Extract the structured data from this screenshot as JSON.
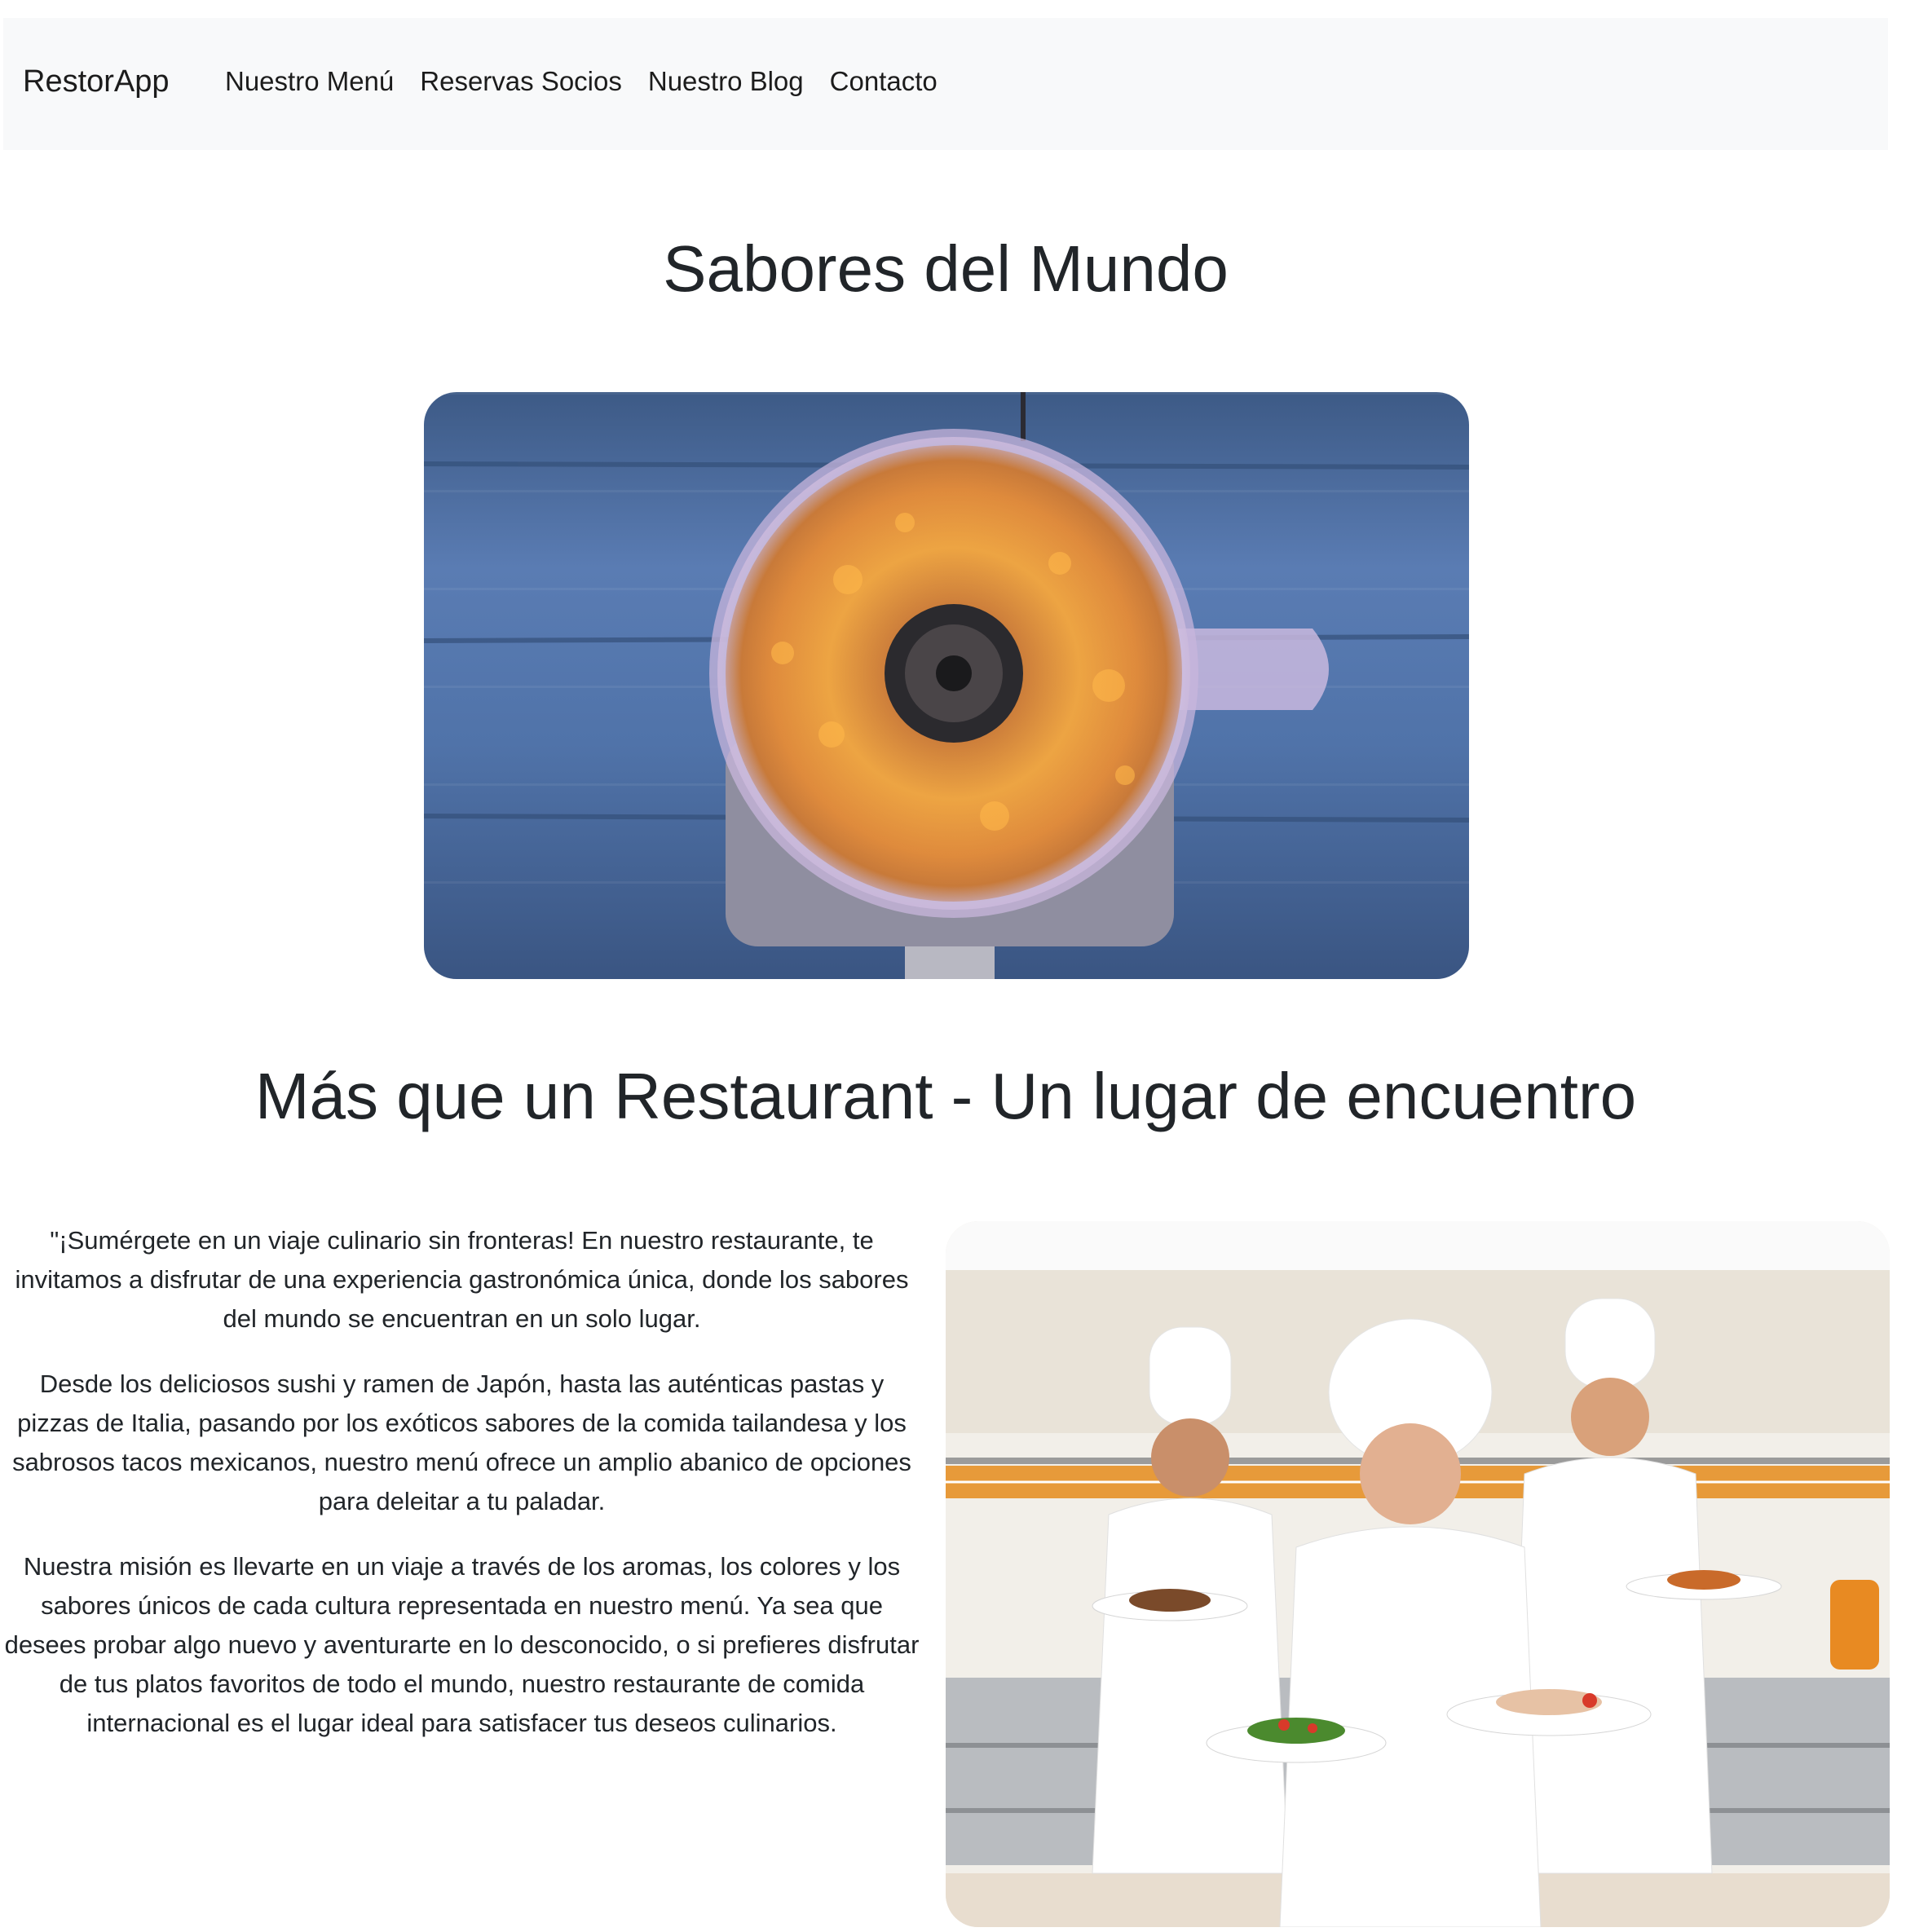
{
  "navbar": {
    "brand": "RestorApp",
    "links": [
      "Nuestro Menú",
      "Reservas Socios",
      "Nuestro Blog",
      "Contacto"
    ]
  },
  "hero": {
    "title": "Sabores del Mundo"
  },
  "about": {
    "heading": "Más que un Restaurant - Un lugar de encuentro",
    "paragraphs": [
      "\"¡Sumérgete en un viaje culinario sin fronteras! En nuestro restaurante, te invitamos a disfrutar de una experiencia gastronómica única, donde los sabores del mundo se encuentran en un solo lugar.",
      "Desde los deliciosos sushi y ramen de Japón, hasta las auténticas pastas y pizzas de Italia, pasando por los exóticos sabores de la comida tailandesa y los sabrosos tacos mexicanos, nuestro menú ofrece un amplio abanico de opciones para deleitar a tu paladar.",
      "Nuestra misión es llevarte en un viaje a través de los aromas, los colores y los sabores únicos de cada cultura representada en nuestro menú. Ya sea que desees probar algo nuevo y aventurarte en lo desconocido, o si prefieres disfrutar de tus platos favoritos de todo el mundo, nuestro restaurante de comida internacional es el lugar ideal para satisfacer tus deseos culinarios."
    ]
  },
  "colors": {
    "navbar_bg": "#f8f9fa",
    "text": "#212529",
    "wood_blue": "#5073a9",
    "food_orange": "#e8891c"
  }
}
